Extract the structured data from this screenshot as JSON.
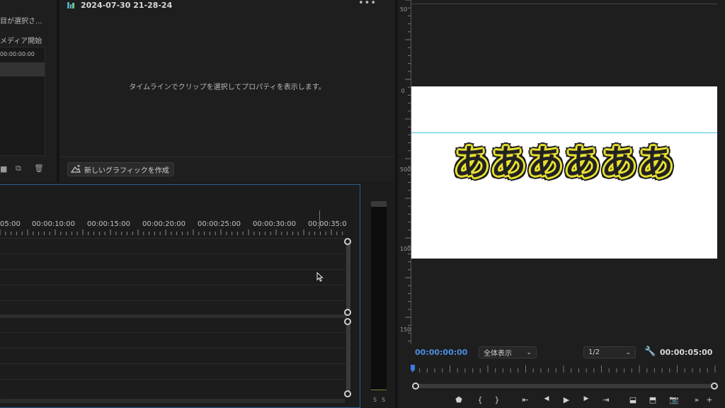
{
  "project_panel": {
    "selected_items_text": "目が選択さ...",
    "media_start_label": "メディア開始",
    "row_timecode": "00:00:00:00"
  },
  "properties_panel": {
    "clip_title": "2024-07-30 21-28-24",
    "more_icon": "ellipsis-icon",
    "empty_message": "タイムラインでクリップを選択してプロパティを表示します。",
    "new_graphic_button": "新しいグラフィックを作成"
  },
  "timeline": {
    "ruler_labels": [
      "05:00",
      "00:00:10:00",
      "00:00:15:00",
      "00:00:20:00",
      "00:00:25:00",
      "00:00:30:00",
      "00:00:35:0"
    ]
  },
  "audio_meter": {
    "solo_labels": [
      "S",
      "S"
    ]
  },
  "program_monitor": {
    "ruler_numbers": [
      "50",
      "0",
      "500",
      "1000",
      "150"
    ],
    "caption_text": "ああああああ",
    "caption_fill_color": "#222222",
    "caption_outline_color": "#e8e030",
    "guide_color": "#49c6d6",
    "current_timecode": "00:00:00:00",
    "zoom_option": "全体表示",
    "resolution_option": "1/2",
    "duration_timecode": "00:00:05:00",
    "accent_color": "#4a8fe0",
    "transport_buttons": [
      {
        "name": "add-marker-icon",
        "glyph": "⬟"
      },
      {
        "name": "mark-in-icon",
        "glyph": "{"
      },
      {
        "name": "mark-out-icon",
        "glyph": "}"
      },
      {
        "name": "go-to-in-icon",
        "glyph": "⇤"
      },
      {
        "name": "step-back-icon",
        "glyph": "◀"
      },
      {
        "name": "play-icon",
        "glyph": "▶"
      },
      {
        "name": "step-forward-icon",
        "glyph": "▶"
      },
      {
        "name": "go-to-out-icon",
        "glyph": "⇥"
      },
      {
        "name": "lift-icon",
        "glyph": "⬓"
      },
      {
        "name": "extract-icon",
        "glyph": "⬒"
      },
      {
        "name": "export-frame-icon",
        "glyph": "📷"
      },
      {
        "name": "more-controls-icon",
        "glyph": "»"
      },
      {
        "name": "add-button-icon",
        "glyph": "+"
      }
    ]
  }
}
